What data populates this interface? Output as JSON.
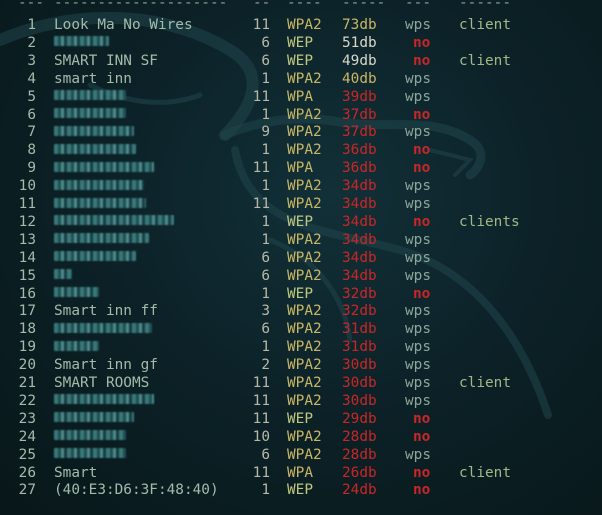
{
  "header": {
    "c1": "---",
    "c2": "--------------------",
    "c3": "--",
    "c4": "----",
    "c5": "-----",
    "c6": "---",
    "c7": "------"
  },
  "colors": {
    "background": "#0c2228",
    "text": "#a2bcaa",
    "wpa2": "#c9b765",
    "no": "#c92727",
    "client": "#a3b887"
  },
  "rows": [
    {
      "idx": "1",
      "name": "Look Ma No Wires",
      "ch": "11",
      "enc": "WPA2",
      "pwr": "73db",
      "wps": "wps",
      "client": "client"
    },
    {
      "idx": "2",
      "name": "",
      "ch": "6",
      "enc": "WEP",
      "pwr": "51db",
      "wps": "no",
      "client": ""
    },
    {
      "idx": "3",
      "name": "SMART INN SF",
      "ch": "6",
      "enc": "WEP",
      "pwr": "49db",
      "wps": "no",
      "client": "client"
    },
    {
      "idx": "4",
      "name": "smart inn",
      "ch": "1",
      "enc": "WPA2",
      "pwr": "40db",
      "wps": "wps",
      "client": ""
    },
    {
      "idx": "5",
      "name": "",
      "ch": "11",
      "enc": "WPA",
      "pwr": "39db",
      "wps": "wps",
      "client": ""
    },
    {
      "idx": "6",
      "name": "",
      "ch": "1",
      "enc": "WPA2",
      "pwr": "37db",
      "wps": "no",
      "client": ""
    },
    {
      "idx": "7",
      "name": "",
      "ch": "9",
      "enc": "WPA2",
      "pwr": "37db",
      "wps": "wps",
      "client": ""
    },
    {
      "idx": "8",
      "name": "",
      "ch": "1",
      "enc": "WPA2",
      "pwr": "36db",
      "wps": "no",
      "client": ""
    },
    {
      "idx": "9",
      "name": "",
      "ch": "11",
      "enc": "WPA",
      "pwr": "36db",
      "wps": "no",
      "client": ""
    },
    {
      "idx": "10",
      "name": "",
      "ch": "1",
      "enc": "WPA2",
      "pwr": "34db",
      "wps": "wps",
      "client": ""
    },
    {
      "idx": "11",
      "name": "",
      "ch": "11",
      "enc": "WPA2",
      "pwr": "34db",
      "wps": "wps",
      "client": ""
    },
    {
      "idx": "12",
      "name": "",
      "ch": "1",
      "enc": "WEP",
      "pwr": "34db",
      "wps": "no",
      "client": "clients"
    },
    {
      "idx": "13",
      "name": "",
      "ch": "1",
      "enc": "WPA2",
      "pwr": "34db",
      "wps": "wps",
      "client": ""
    },
    {
      "idx": "14",
      "name": "",
      "ch": "6",
      "enc": "WPA2",
      "pwr": "34db",
      "wps": "wps",
      "client": ""
    },
    {
      "idx": "15",
      "name": "",
      "ch": "6",
      "enc": "WPA2",
      "pwr": "34db",
      "wps": "wps",
      "client": ""
    },
    {
      "idx": "16",
      "name": "",
      "ch": "1",
      "enc": "WEP",
      "pwr": "32db",
      "wps": "no",
      "client": ""
    },
    {
      "idx": "17",
      "name": "Smart inn ff",
      "ch": "3",
      "enc": "WPA2",
      "pwr": "32db",
      "wps": "wps",
      "client": ""
    },
    {
      "idx": "18",
      "name": "",
      "ch": "6",
      "enc": "WPA2",
      "pwr": "31db",
      "wps": "wps",
      "client": ""
    },
    {
      "idx": "19",
      "name": "",
      "ch": "1",
      "enc": "WPA2",
      "pwr": "31db",
      "wps": "wps",
      "client": ""
    },
    {
      "idx": "20",
      "name": "Smart inn gf",
      "ch": "2",
      "enc": "WPA2",
      "pwr": "30db",
      "wps": "wps",
      "client": ""
    },
    {
      "idx": "21",
      "name": "SMART ROOMS",
      "ch": "11",
      "enc": "WPA2",
      "pwr": "30db",
      "wps": "wps",
      "client": "client"
    },
    {
      "idx": "22",
      "name": "",
      "ch": "11",
      "enc": "WPA2",
      "pwr": "30db",
      "wps": "wps",
      "client": ""
    },
    {
      "idx": "23",
      "name": "",
      "ch": "11",
      "enc": "WEP",
      "pwr": "29db",
      "wps": "no",
      "client": ""
    },
    {
      "idx": "24",
      "name": "",
      "ch": "10",
      "enc": "WPA2",
      "pwr": "28db",
      "wps": "no",
      "client": ""
    },
    {
      "idx": "25",
      "name": "",
      "ch": "6",
      "enc": "WPA2",
      "pwr": "28db",
      "wps": "wps",
      "client": ""
    },
    {
      "idx": "26",
      "name": "Smart",
      "ch": "11",
      "enc": "WPA",
      "pwr": "26db",
      "wps": "no",
      "client": "client"
    },
    {
      "idx": "27",
      "name": "(40:E3:D6:3F:48:40)",
      "ch": "1",
      "enc": "WEP",
      "pwr": "24db",
      "wps": "no",
      "client": ""
    }
  ]
}
